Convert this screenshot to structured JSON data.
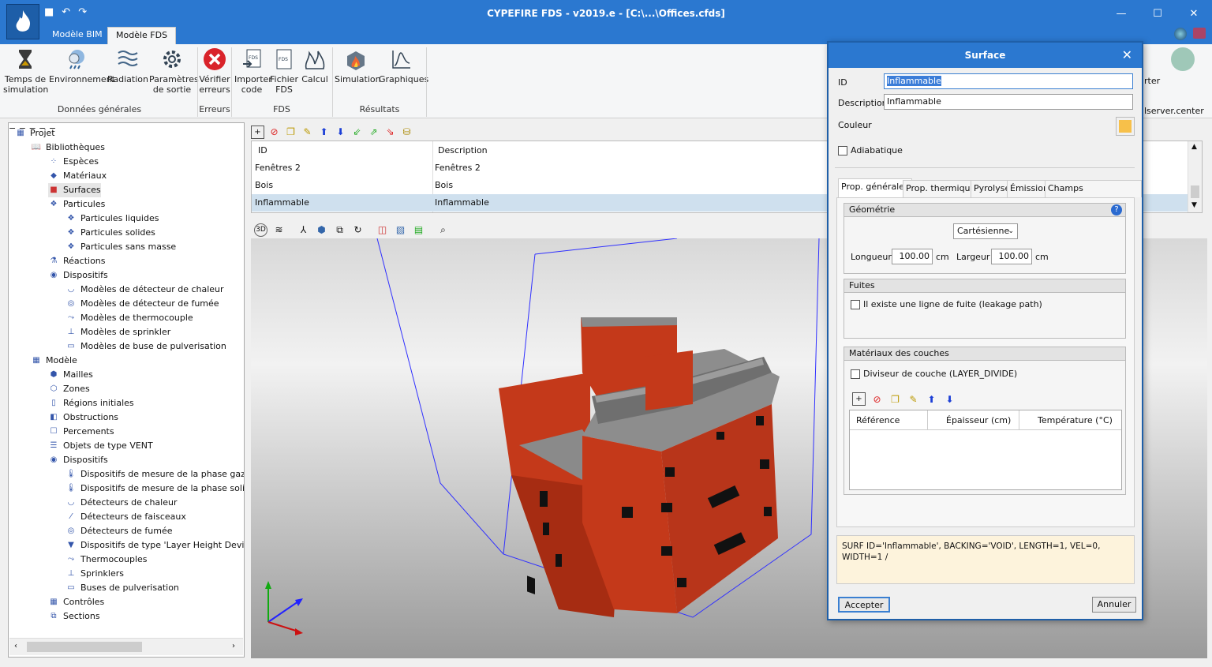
{
  "app": {
    "title": "CYPEFIRE FDS - v2019.e - [C:\\...\\Offices.cfds]",
    "tabs": [
      "Modèle BIM",
      "Modèle FDS"
    ]
  },
  "ribbon": {
    "buttons": [
      {
        "label": "Temps de simulation",
        "icon": "hourglass-icon"
      },
      {
        "label": "Environnement",
        "icon": "weather-icon"
      },
      {
        "label": "Radiation",
        "icon": "radiation-icon"
      },
      {
        "label": "Paramètres de sortie",
        "icon": "gear-icon"
      },
      {
        "label": "Vérifier erreurs",
        "icon": "error-icon"
      },
      {
        "label": "Importer code",
        "icon": "import-icon"
      },
      {
        "label": "Fichier FDS",
        "icon": "file-icon"
      },
      {
        "label": "Calcul",
        "icon": "fire-icon"
      },
      {
        "label": "Simulation",
        "icon": "simulation-icon"
      },
      {
        "label": "Graphiques",
        "icon": "chart-icon"
      }
    ],
    "groups": [
      "Données générales",
      "Erreurs",
      "FDS",
      "Résultats"
    ],
    "right_partial": [
      "rter",
      "lserver.center"
    ]
  },
  "tree": {
    "items": [
      {
        "label": "Projet"
      },
      {
        "label": "Bibliothèques"
      },
      {
        "label": "Espèces"
      },
      {
        "label": "Matériaux"
      },
      {
        "label": "Surfaces"
      },
      {
        "label": "Particules"
      },
      {
        "label": "Particules liquides"
      },
      {
        "label": "Particules solides"
      },
      {
        "label": "Particules sans masse"
      },
      {
        "label": "Réactions"
      },
      {
        "label": "Dispositifs"
      },
      {
        "label": "Modèles de détecteur de chaleur"
      },
      {
        "label": "Modèles de détecteur de fumée"
      },
      {
        "label": "Modèles de thermocouple"
      },
      {
        "label": "Modèles de sprinkler"
      },
      {
        "label": "Modèles de buse de pulverisation"
      },
      {
        "label": "Modèle"
      },
      {
        "label": "Mailles"
      },
      {
        "label": "Zones"
      },
      {
        "label": "Régions initiales"
      },
      {
        "label": "Obstructions"
      },
      {
        "label": "Percements"
      },
      {
        "label": "Objets de type VENT"
      },
      {
        "label": "Dispositifs"
      },
      {
        "label": "Dispositifs de mesure de la phase gazeuse"
      },
      {
        "label": "Dispositifs de mesure de la phase solide"
      },
      {
        "label": "Détecteurs de chaleur"
      },
      {
        "label": "Détecteurs de faisceaux"
      },
      {
        "label": "Détecteurs de fumée"
      },
      {
        "label": "Dispositifs de type 'Layer Height Device' po"
      },
      {
        "label": "Thermocouples"
      },
      {
        "label": "Sprinklers"
      },
      {
        "label": "Buses de pulverisation"
      },
      {
        "label": "Contrôles"
      },
      {
        "label": "Sections"
      }
    ]
  },
  "table": {
    "headers": [
      "ID",
      "Description"
    ],
    "rows": [
      [
        "Fenêtres 2",
        "Fenêtres 2"
      ],
      [
        "Bois",
        "Bois"
      ],
      [
        "Inflammable",
        "Inflammable"
      ]
    ],
    "selected_row": 2
  },
  "dialog": {
    "title": "Surface",
    "id_label": "ID",
    "id_value": "Inflammable",
    "desc_label": "Description",
    "desc_value": "Inflammable",
    "color_label": "Couleur",
    "color": "#f7c04a",
    "adiabatic_label": "Adiabatique",
    "tabs": [
      "Prop. générales",
      "Prop. thermiques",
      "Pyrolyse",
      "Émission",
      "Champs additionnels"
    ],
    "geometry": {
      "title": "Géométrie",
      "type": "Cartésienne",
      "length_label": "Longueur",
      "length_value": "100.00",
      "width_label": "Largeur",
      "width_value": "100.00",
      "unit": "cm"
    },
    "leaks": {
      "title": "Fuites",
      "checkbox_label": "Il existe une ligne de fuite (leakage path)"
    },
    "layers": {
      "title": "Matériaux des couches",
      "divider_label": "Diviseur de couche (LAYER_DIVIDE)",
      "columns": [
        "Référence",
        "Épaisseur (cm)",
        "Température (°C)"
      ]
    },
    "code": "SURF ID='Inflammable', BACKING='VOID', LENGTH=1, VEL=0, WIDTH=1 /",
    "accept": "Accepter",
    "cancel": "Annuler"
  },
  "colors": {
    "titlebar": "#2b78d0",
    "building": "#c4391a",
    "selection": "#cfe0ee"
  }
}
